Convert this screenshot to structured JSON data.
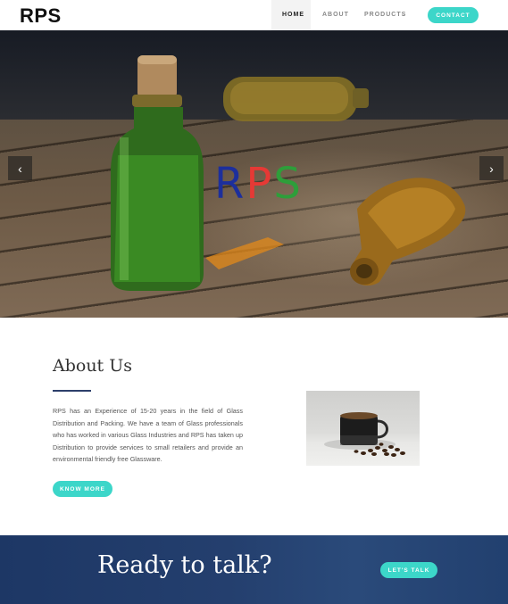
{
  "brand": {
    "logo": "RPS"
  },
  "nav": {
    "home": "HOME",
    "about": "ABOUT",
    "products": "PRODUCTS",
    "contact": "CONTACT"
  },
  "hero": {
    "brand_letters": [
      {
        "char": "R",
        "color": "#1d2f9c"
      },
      {
        "char": "P",
        "color": "#e53935"
      },
      {
        "char": "S",
        "color": "#2e9e3a"
      }
    ],
    "prev_icon": "chevron-left-icon",
    "next_icon": "chevron-right-icon"
  },
  "about": {
    "title": "About Us",
    "body": "RPS has an Experience of 15-20 years in the field of Glass Distribution and Packing. We have a team of Glass professionals who has worked in various Glass Industries and RPS has taken up Distribution to provide services to small retailers and provide an environmental friendly free Glassware.",
    "button": "KNOW MORE"
  },
  "cta": {
    "title": "Ready to talk?",
    "button": "LET'S TALK"
  },
  "colors": {
    "accent": "#3cd6c9",
    "cta_bg": "#1d3765",
    "rule": "#2d3f6b"
  }
}
